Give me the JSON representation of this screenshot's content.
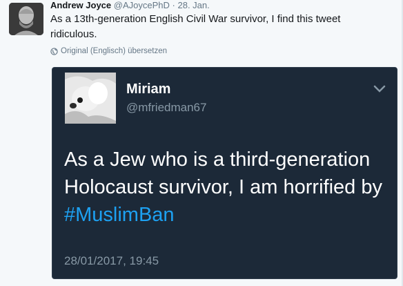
{
  "tweet": {
    "author_name": "Andrew Joyce",
    "author_handle": "@AJoycePhD",
    "separator": "·",
    "date": "28. Jan.",
    "text": "As a 13th-generation English Civil War survivor, I find this tweet ridiculous.",
    "translate_label": "Original (Englisch) übersetzen",
    "avatar_icon": "bust-avatar-icon"
  },
  "quoted": {
    "name": "Miriam",
    "handle": "@mfriedman67",
    "text_before_hashtag": "As a Jew who is a third-generation Holocaust survivor, I am horrified by ",
    "hashtag": "#MuslimBan",
    "timestamp": "28/01/2017, 19:45",
    "menu_icon": "chevron-down-icon",
    "avatar_icon": "dog-avatar-icon"
  },
  "colors": {
    "page_bg": "#f5f8fa",
    "card_bg": "#1c2938",
    "hashtag": "#1da1f2",
    "secondary_text": "#657786"
  }
}
